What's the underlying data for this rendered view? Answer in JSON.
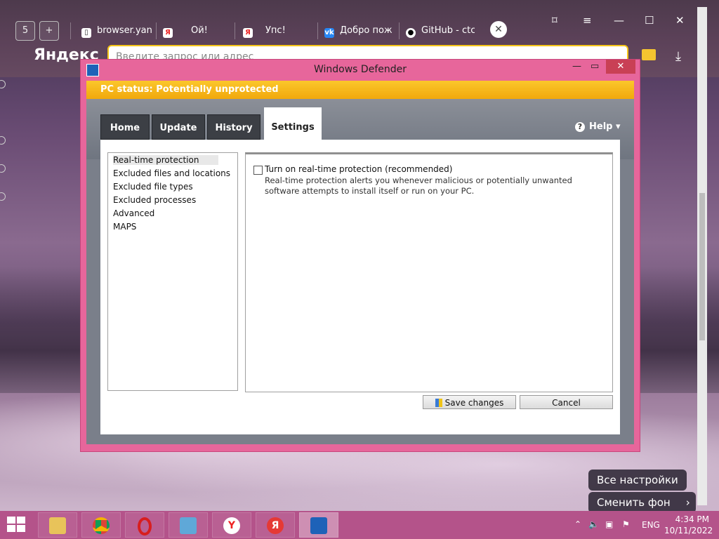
{
  "browser": {
    "tab_count": "5",
    "tabs": [
      {
        "label": "browser.yan",
        "icon": "document-icon"
      },
      {
        "label": "Ой!",
        "icon": "yandex-icon"
      },
      {
        "label": "Упс!",
        "icon": "yandex-icon"
      },
      {
        "label": "Добро пож",
        "icon": "vk-icon"
      },
      {
        "label": "GitHub - ctc",
        "icon": "github-icon"
      }
    ],
    "logo": "Яндекс",
    "address_placeholder": "Введите запрос или адрес"
  },
  "desktop": {
    "all_settings_button": "Все настройки",
    "change_bg_button": "Сменить фон"
  },
  "defender": {
    "title": "Windows Defender",
    "status": "PC status: Potentially unprotected",
    "tabs": [
      "Home",
      "Update",
      "History",
      "Settings"
    ],
    "active_tab": "Settings",
    "help_label": "Help",
    "side_items": [
      "Real-time protection",
      "Excluded files and locations",
      "Excluded file types",
      "Excluded processes",
      "Advanced",
      "MAPS"
    ],
    "selected_item": "Real-time protection",
    "checkbox_label": "Turn on real-time protection (recommended)",
    "checkbox_checked": false,
    "description": "Real-time protection alerts you whenever malicious or potentially unwanted software attempts to install itself or run on your PC.",
    "save_button": "Save changes",
    "cancel_button": "Cancel"
  },
  "taskbar": {
    "language": "ENG",
    "time": "4:34 PM",
    "date": "10/11/2022"
  },
  "colors": {
    "status_bar": "#f5b71a",
    "window_frame": "#e7669b",
    "taskbar": "#b4538a"
  }
}
